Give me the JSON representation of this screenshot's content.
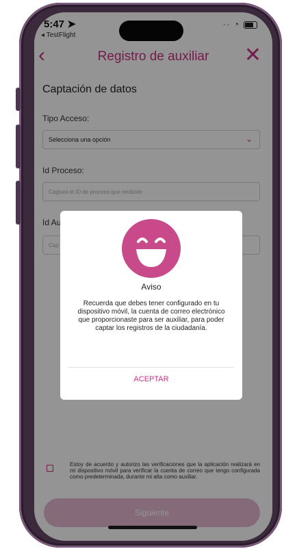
{
  "status_bar": {
    "time": "5:47",
    "back_app": "TestFlight"
  },
  "nav": {
    "back_icon": "chevron-left-icon",
    "title": "Registro de auxiliar",
    "close_icon": "close-icon"
  },
  "form": {
    "section_title": "Captación de datos",
    "tipo_acceso_label": "Tipo Acceso:",
    "tipo_acceso_value": "Selecciona una opción",
    "id_proceso_label": "Id Proceso:",
    "id_proceso_placeholder": "Captura el ID de proceso que recibiste",
    "id_aux_label": "Id Au",
    "id_aux_placeholder": "Cap"
  },
  "consent_text": "Estoy de acuerdo y autorizo las verificaciones que la aplicación realizará en mi dispositivo móvil para verificar la cuenta de correo que tengo configurada como predeterminada, durante mi alta como auxiliar.",
  "next_button": "Siguiente",
  "modal": {
    "icon": "smiley-icon",
    "title": "Aviso",
    "message": "Recuerda que debes tener configurado en tu dispositivo móvil, la cuenta de correo electrónico que proporcionaste para ser auxiliar, para poder captar los registros de la ciudadanía.",
    "accept_label": "ACEPTAR"
  },
  "colors": {
    "accent": "#cc2e84",
    "smiley": "#c84a8a",
    "disabled_button": "#e6b8d0"
  }
}
